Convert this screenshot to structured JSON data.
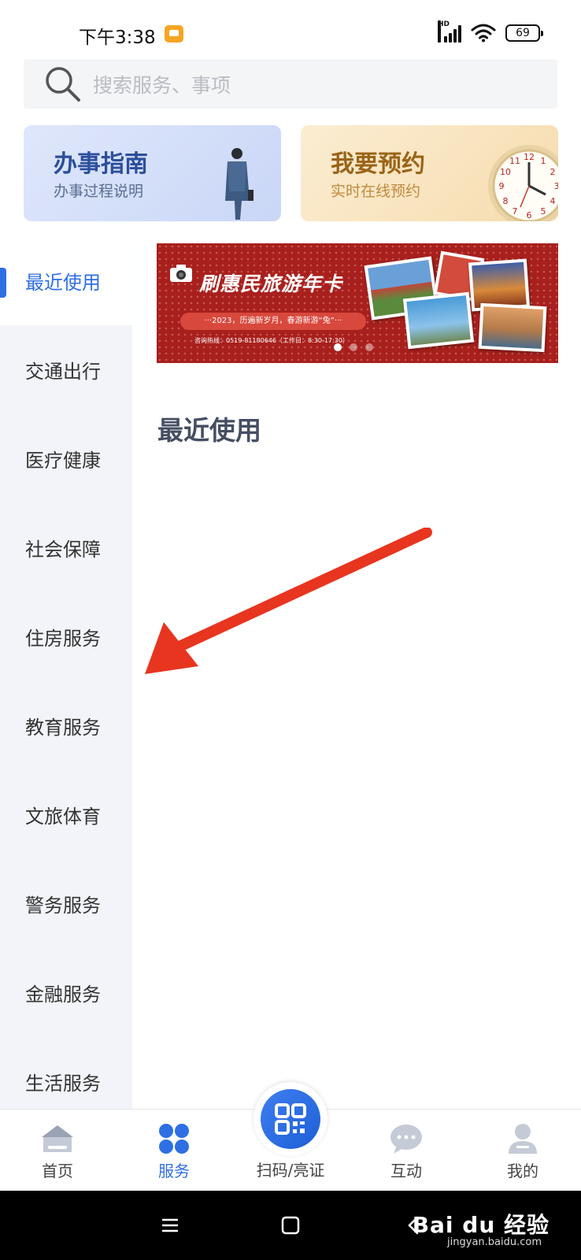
{
  "status_bar": {
    "time": "下午3:38",
    "battery": "69",
    "hd_label": "HD"
  },
  "search": {
    "placeholder": "搜索服务、事项"
  },
  "cards": [
    {
      "title": "办事指南",
      "subtitle": "办事过程说明"
    },
    {
      "title": "我要预约",
      "subtitle": "实时在线预约"
    }
  ],
  "sidebar": {
    "items": [
      {
        "label": "最近使用",
        "active": true
      },
      {
        "label": "交通出行"
      },
      {
        "label": "医疗健康"
      },
      {
        "label": "社会保障"
      },
      {
        "label": "住房服务"
      },
      {
        "label": "教育服务"
      },
      {
        "label": "文旅体育"
      },
      {
        "label": "警务服务"
      },
      {
        "label": "金融服务"
      },
      {
        "label": "生活服务"
      }
    ]
  },
  "banner": {
    "title": "刷惠民旅游年卡",
    "tagline": "···2023，历遍新岁月，春游新游“兔”···",
    "hotline": "咨询热线：0519-81180646（工作日：8:30-17:30）",
    "page_count": 3,
    "active_page": 1
  },
  "main": {
    "section_title": "最近使用"
  },
  "tab_bar": {
    "home": "首页",
    "service": "服务",
    "scan": "扫码/亮证",
    "interact": "互动",
    "mine": "我的"
  },
  "watermark": {
    "brand": "Bai du 经验",
    "url": "jingyan.baidu.com"
  },
  "colors": {
    "accent": "#2f6fe4",
    "annotation_arrow": "#e8351f",
    "banner_red": "#a8201d"
  }
}
